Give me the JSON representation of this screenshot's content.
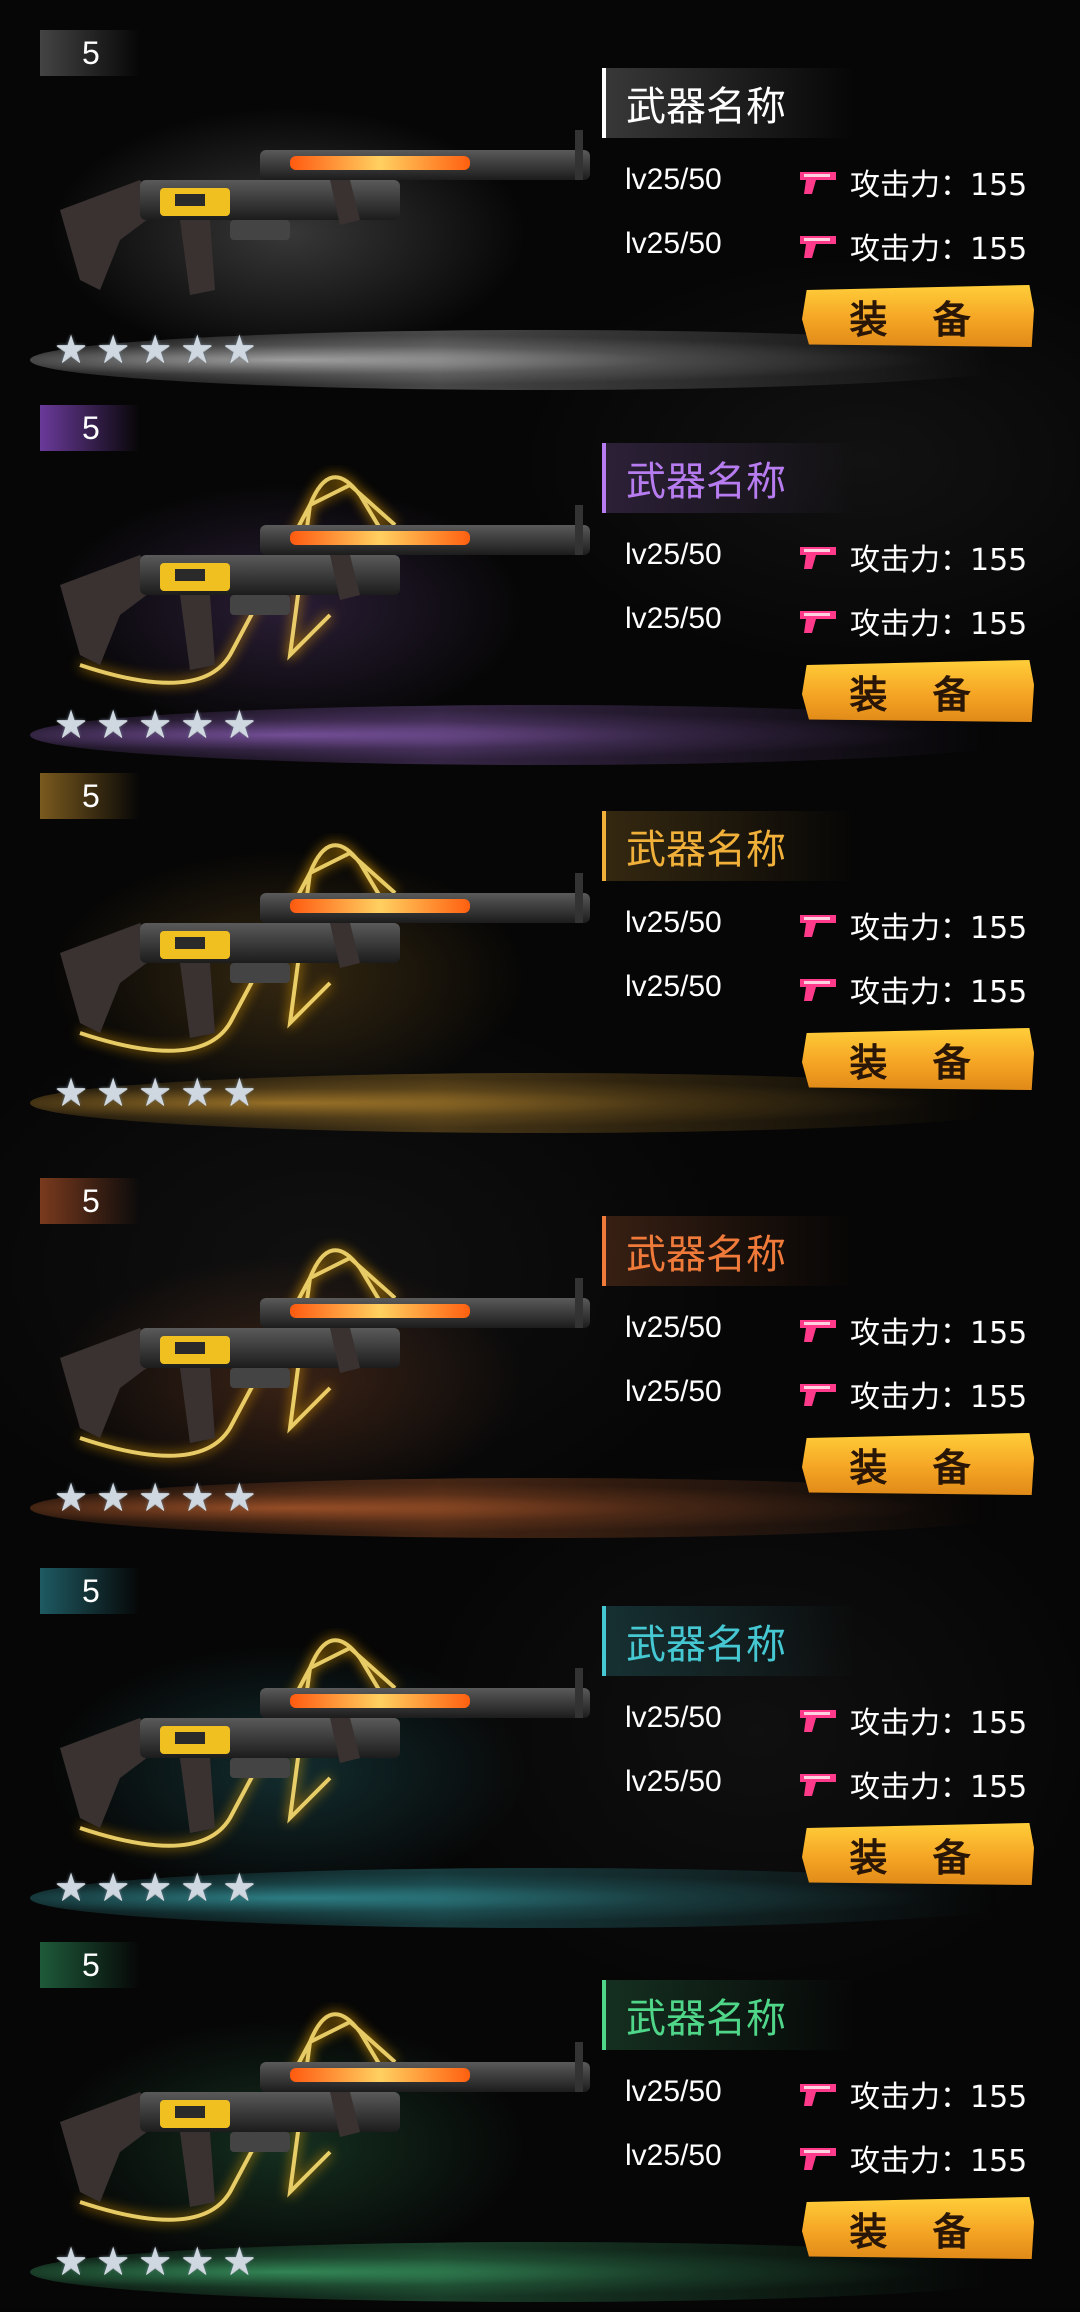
{
  "cards": [
    {
      "level": "5",
      "name": "武器名称",
      "lv1": "lv25/50",
      "lv2": "lv25/50",
      "atk1": "攻击力：155",
      "atk2": "攻击力：155",
      "equip": "装 备",
      "theme": "white",
      "color": "#ffffff",
      "badge": "#444444",
      "stars": 5
    },
    {
      "level": "5",
      "name": "武器名称",
      "lv1": "lv25/50",
      "lv2": "lv25/50",
      "atk1": "攻击力：155",
      "atk2": "攻击力：155",
      "equip": "装 备",
      "theme": "purple",
      "color": "#b77cf0",
      "badge": "#6a3a9a",
      "stars": 5
    },
    {
      "level": "5",
      "name": "武器名称",
      "lv1": "lv25/50",
      "lv2": "lv25/50",
      "atk1": "攻击力：155",
      "atk2": "攻击力：155",
      "equip": "装 备",
      "theme": "gold",
      "color": "#f0b03a",
      "badge": "#7a5a1e",
      "stars": 5
    },
    {
      "level": "5",
      "name": "武器名称",
      "lv1": "lv25/50",
      "lv2": "lv25/50",
      "atk1": "攻击力：155",
      "atk2": "攻击力：155",
      "equip": "装 备",
      "theme": "orange",
      "color": "#f07a3a",
      "badge": "#7a3a1e",
      "stars": 5
    },
    {
      "level": "5",
      "name": "武器名称",
      "lv1": "lv25/50",
      "lv2": "lv25/50",
      "atk1": "攻击力：155",
      "atk2": "攻击力：155",
      "equip": "装 备",
      "theme": "teal",
      "color": "#45c8d2",
      "badge": "#1e5a62",
      "stars": 5
    },
    {
      "level": "5",
      "name": "武器名称",
      "lv1": "lv25/50",
      "lv2": "lv25/50",
      "atk1": "攻击力：155",
      "atk2": "攻击力：155",
      "equip": "装 备",
      "theme": "green",
      "color": "#4fd688",
      "badge": "#1e5a3a",
      "stars": 5
    }
  ]
}
